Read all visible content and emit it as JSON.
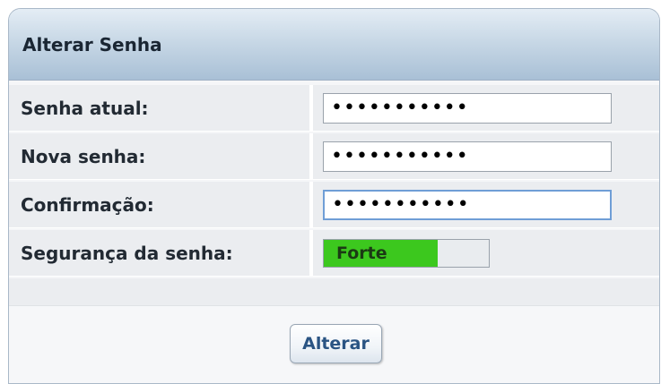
{
  "panel": {
    "title": "Alterar Senha"
  },
  "form": {
    "current_password": {
      "label": "Senha atual:",
      "value": "•••••••••••"
    },
    "new_password": {
      "label": "Nova senha:",
      "value": "•••••••••••"
    },
    "confirm_password": {
      "label": "Confirmação:",
      "value": "•••••••••••"
    },
    "strength": {
      "label": "Segurança da senha:",
      "text": "Forte",
      "level_fraction": 0.69,
      "color": "#3cc81e"
    }
  },
  "actions": {
    "submit_label": "Alterar"
  },
  "colors": {
    "header_accent": "#a9c0d6",
    "button_text": "#2a5483",
    "focus_border": "#6f9ed6"
  }
}
